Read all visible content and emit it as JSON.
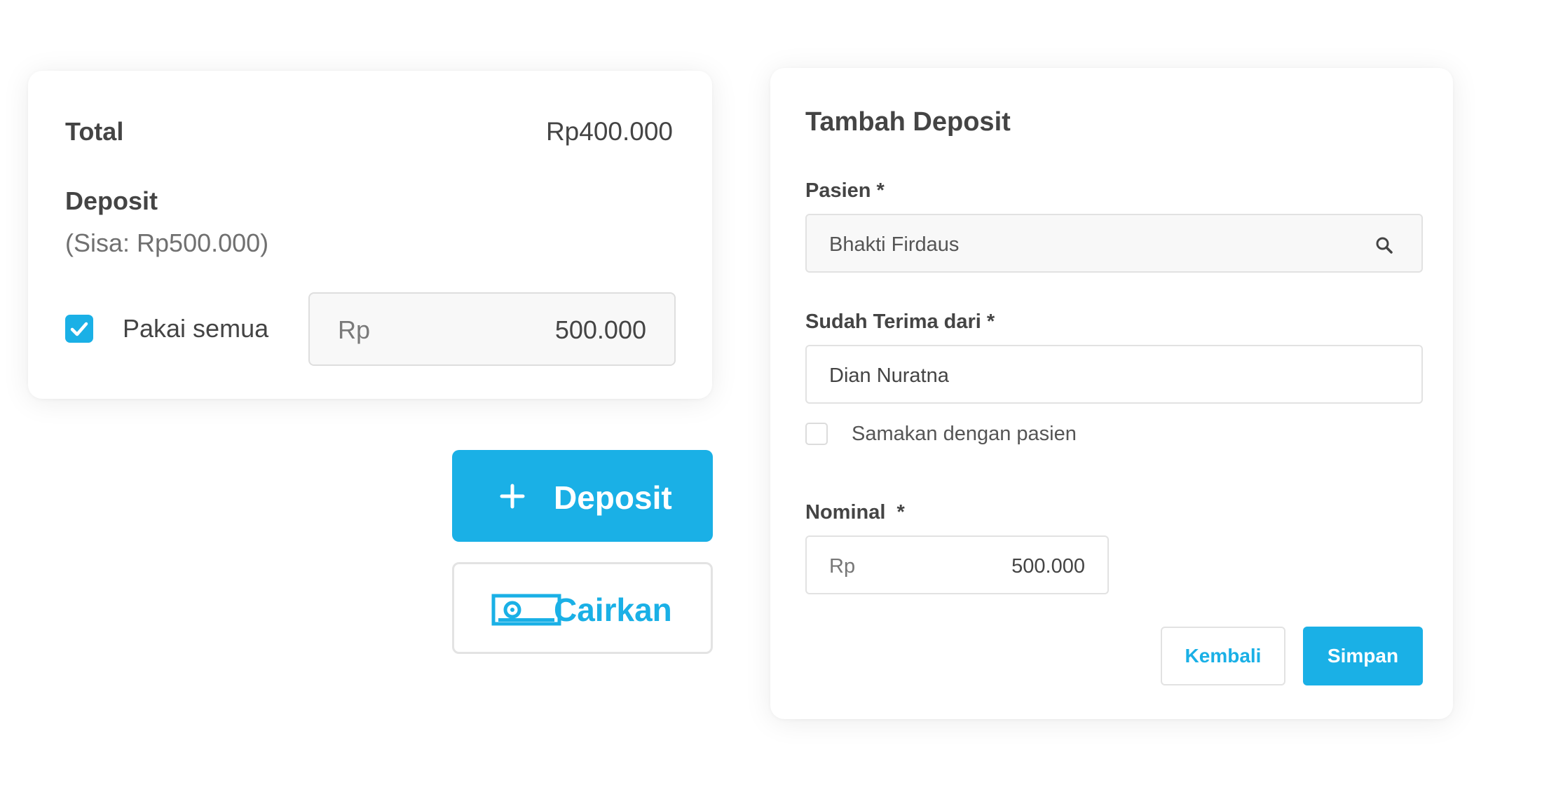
{
  "summary": {
    "total_label": "Total",
    "total_value": "Rp400.000",
    "deposit_label": "Deposit",
    "deposit_remaining": "(Sisa: Rp500.000)",
    "use_all_label": "Pakai semua",
    "use_all_checked": true,
    "currency": "Rp",
    "amount": "500.000"
  },
  "actions": {
    "deposit_label": "Deposit",
    "deposit_icon": "plus-icon",
    "withdraw_label": "Cairkan",
    "withdraw_icon": "banknote-icon"
  },
  "form": {
    "title": "Tambah Deposit",
    "patient_label": "Pasien *",
    "patient_value": "Bhakti Firdaus",
    "patient_icon": "search-icon",
    "received_from_label": "Sudah Terima dari *",
    "received_from_value": "Dian Nuratna",
    "same_as_patient_label": "Samakan dengan pasien",
    "same_as_patient_checked": false,
    "nominal_label": "Nominal  *",
    "nominal_currency": "Rp",
    "nominal_value": "500.000",
    "back_label": "Kembali",
    "save_label": "Simpan"
  },
  "colors": {
    "accent": "#1ab0e6",
    "text": "#444444",
    "muted": "#6f6f6f",
    "border": "#e2e2e2",
    "input_bg": "#f8f8f8"
  }
}
